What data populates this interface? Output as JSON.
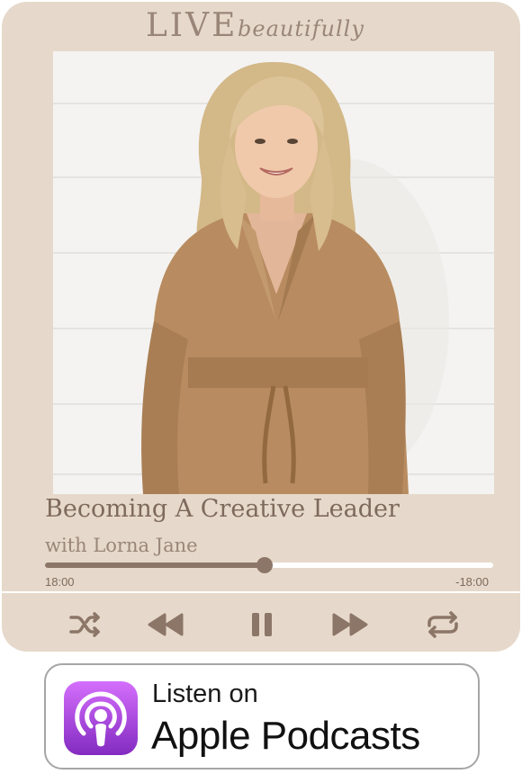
{
  "brand": {
    "main": "LIVE",
    "script": "beautifully"
  },
  "episode": {
    "title": "Becoming A Creative Leader",
    "guest": "with Lorna Jane"
  },
  "player": {
    "progress_fraction": 0.49,
    "elapsed": "18:00",
    "remaining": "-18:00",
    "controls": [
      "shuffle-icon",
      "rewind-icon",
      "pause-icon",
      "fast-forward-icon",
      "repeat-icon"
    ]
  },
  "badge": {
    "line1": "Listen on",
    "line2": "Apple Podcasts",
    "icon": "apple-podcasts-icon"
  },
  "colors": {
    "card": "#e6d9cb",
    "accent": "#8c7668",
    "text": "#7e6a5c",
    "podcasts_purple": "#9b3fd6"
  }
}
